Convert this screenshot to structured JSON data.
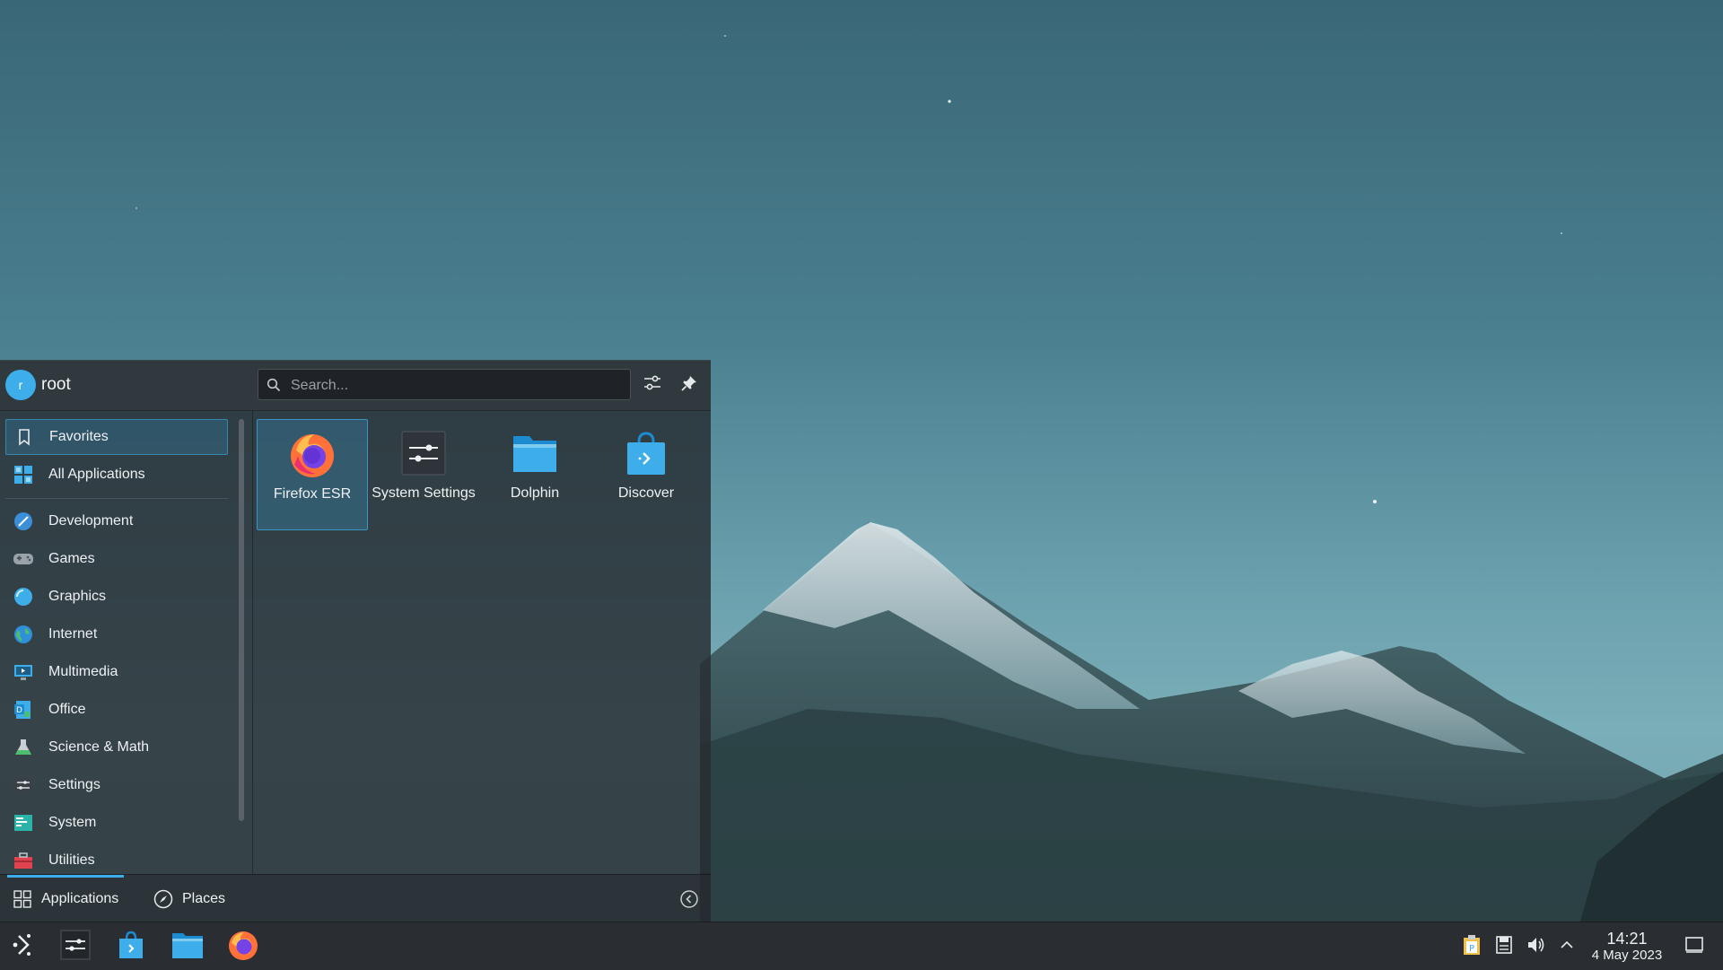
{
  "launcher": {
    "user": {
      "initial": "r",
      "name": "root"
    },
    "search": {
      "placeholder": "Search..."
    },
    "sidebar": {
      "items": [
        {
          "label": "Favorites",
          "icon": "bookmark-icon",
          "active": true
        },
        {
          "label": "All Applications",
          "icon": "grid-icon"
        },
        {
          "label": "Development",
          "icon": "development-icon"
        },
        {
          "label": "Games",
          "icon": "gamepad-icon"
        },
        {
          "label": "Graphics",
          "icon": "graphics-icon"
        },
        {
          "label": "Internet",
          "icon": "globe-icon"
        },
        {
          "label": "Multimedia",
          "icon": "multimedia-icon"
        },
        {
          "label": "Office",
          "icon": "office-icon"
        },
        {
          "label": "Science & Math",
          "icon": "flask-icon"
        },
        {
          "label": "Settings",
          "icon": "settings-icon"
        },
        {
          "label": "System",
          "icon": "system-icon"
        },
        {
          "label": "Utilities",
          "icon": "toolbox-icon"
        }
      ]
    },
    "favorites": [
      {
        "label": "Firefox ESR",
        "icon": "firefox-icon",
        "active": true
      },
      {
        "label": "System Settings",
        "icon": "system-settings-icon"
      },
      {
        "label": "Dolphin",
        "icon": "folder-icon"
      },
      {
        "label": "Discover",
        "icon": "shopping-bag-icon"
      }
    ],
    "footer": {
      "applications": "Applications",
      "places": "Places"
    }
  },
  "taskbar": {
    "apps": [
      "app-launcher-icon",
      "system-settings-icon",
      "discover-icon",
      "dolphin-icon",
      "firefox-icon"
    ],
    "tray": [
      "clipboard-icon",
      "storage-icon",
      "volume-icon",
      "chevron-up-icon"
    ],
    "clock": {
      "time": "14:21",
      "date": "4 May 2023"
    }
  },
  "colors": {
    "accent": "#3daee9",
    "panel": "#2a2e32"
  }
}
